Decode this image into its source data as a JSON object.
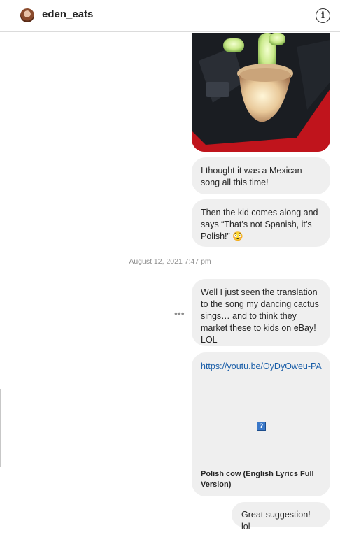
{
  "header": {
    "username": "eden_eats",
    "info_icon_glyph": "i"
  },
  "messages": [
    {
      "text": "I thought it was a Mexican song all this time!"
    },
    {
      "text": "Then the kid comes along and says “That’s not Spanish, it’s Polish!” 😳"
    }
  ],
  "timestamp": "August 12, 2021 7:47 pm",
  "message_long": "Well I just seen the translation to the song my dancing cactus sings… and to think they market these to kids on eBay! LOL",
  "more_options": "•••",
  "link_card": {
    "url": "https://youtu.be/OyDyOweu-PA",
    "image_placeholder": "?",
    "title": "Polish cow (English Lyrics Full Version)"
  },
  "message_last": "Great suggestion! lol",
  "colors": {
    "bubble": "#efefef",
    "link": "#1a5ea8",
    "timestamp": "#8e8e8e"
  },
  "icons": [
    "avatar-photo",
    "info-icon",
    "more-options-icon",
    "broken-image-icon"
  ]
}
